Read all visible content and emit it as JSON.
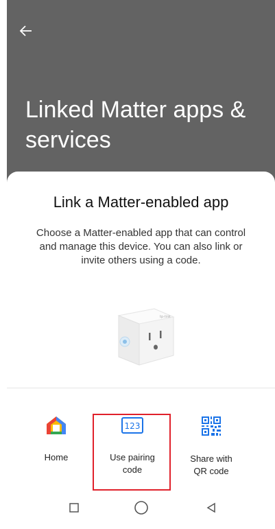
{
  "header": {
    "title": "Linked Matter apps & services"
  },
  "sheet": {
    "title": "Link a Matter-enabled app",
    "description": "Choose a Matter-enabled app that can control and manage this device. You can also link or invite others using a code."
  },
  "options": [
    {
      "label": "Home",
      "icon": "google-home-icon"
    },
    {
      "label": "Use pairing\ncode",
      "icon": "pairing-code-123-icon"
    },
    {
      "label": "Share with\nQR code",
      "icon": "qr-code-icon"
    }
  ],
  "navbar": {
    "items": [
      "recents-square",
      "home-circle",
      "back-triangle"
    ]
  },
  "colors": {
    "highlight": "#e0202a",
    "scrim": "#636363",
    "accent": "#1a73e8"
  }
}
